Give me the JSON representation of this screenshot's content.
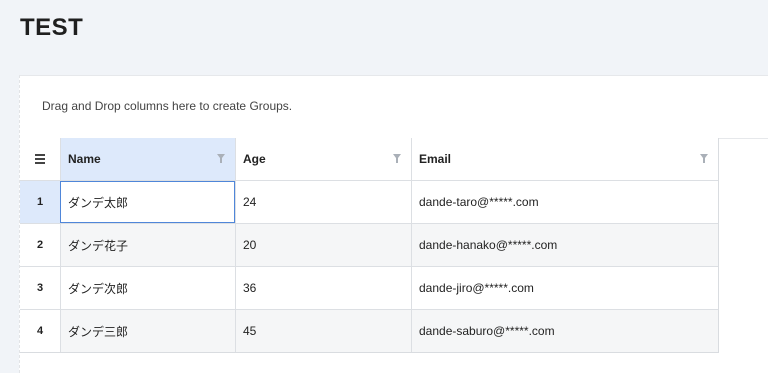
{
  "page": {
    "title": "TEST"
  },
  "group_panel": {
    "text": "Drag and Drop columns here to create Groups."
  },
  "grid": {
    "menu_icon": "hamburger-menu-icon",
    "columns": [
      {
        "label": "Name",
        "filter_icon": "filter-icon"
      },
      {
        "label": "Age",
        "filter_icon": "filter-icon"
      },
      {
        "label": "Email",
        "filter_icon": "filter-icon"
      }
    ],
    "rows": [
      {
        "index": "1",
        "name": "ダンデ太郎",
        "age": "24",
        "email": "dande-taro@*****.com"
      },
      {
        "index": "2",
        "name": "ダンデ花子",
        "age": "20",
        "email": "dande-hanako@*****.com"
      },
      {
        "index": "3",
        "name": "ダンデ次郎",
        "age": "36",
        "email": "dande-jiro@*****.com"
      },
      {
        "index": "4",
        "name": "ダンデ三郎",
        "age": "45",
        "email": "dande-saburo@*****.com"
      }
    ]
  },
  "colors": {
    "page_bg": "#f1f4f8",
    "header_active": "#dde9fb",
    "selected_outline": "#4f86d9",
    "alt_row": "#f5f6f7"
  }
}
